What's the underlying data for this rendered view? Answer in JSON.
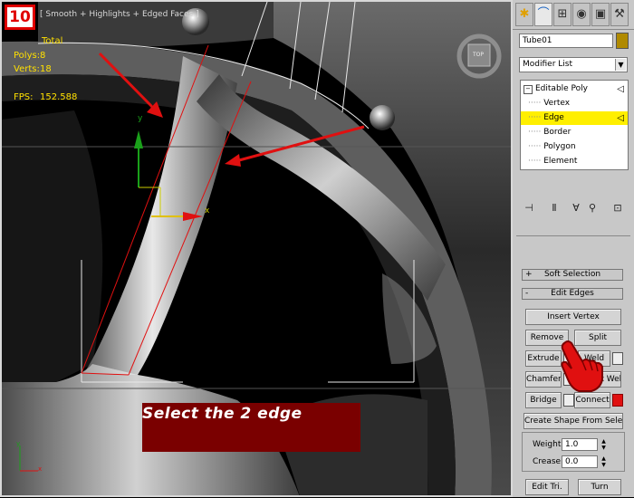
{
  "step_number": "10",
  "viewport": {
    "label": "[ Smooth + Highlights + Edged Faces ]",
    "stats": {
      "total_label": "Total",
      "polys_label": "Polys:",
      "polys_value": "8",
      "verts_label": "Verts:",
      "verts_value": "18",
      "fps_label": "FPS:",
      "fps_value": "152.588"
    },
    "viewcube_label": "TOP",
    "axis_y": "y",
    "axis_x": "x",
    "colors": {
      "stats": "#ffe000",
      "arrow": "#e01010",
      "gizmo_y": "#1aa01a",
      "gizmo_x": "#e01010"
    }
  },
  "caption": "Select the 2 edge",
  "panel": {
    "tabs": [
      "create-tab",
      "modify-tab",
      "hierarchy-tab",
      "motion-tab",
      "display-tab",
      "utilities-tab"
    ],
    "object_name": "Tube01",
    "modifier_list": "Modifier List",
    "stack": {
      "root": "Editable Poly",
      "items": [
        "Vertex",
        "Edge",
        "Border",
        "Polygon",
        "Element"
      ],
      "selected": "Edge"
    },
    "rollouts": {
      "soft_selection": "Soft Selection",
      "edit_edges": "Edit Edges",
      "plus": "+",
      "minus": "-"
    },
    "buttons": {
      "insert_vertex": "Insert Vertex",
      "remove": "Remove",
      "split": "Split",
      "extrude": "Extrude",
      "weld": "Weld",
      "chamfer": "Chamfer",
      "target_weld": "Target Weld",
      "bridge": "Bridge",
      "connect": "Connect",
      "create_shape": "Create Shape From Selection",
      "edit_tri": "Edit Tri.",
      "turn": "Turn"
    },
    "weight_label": "Weight:",
    "weight_value": "1.0",
    "crease_label": "Crease:",
    "crease_value": "0.0"
  }
}
